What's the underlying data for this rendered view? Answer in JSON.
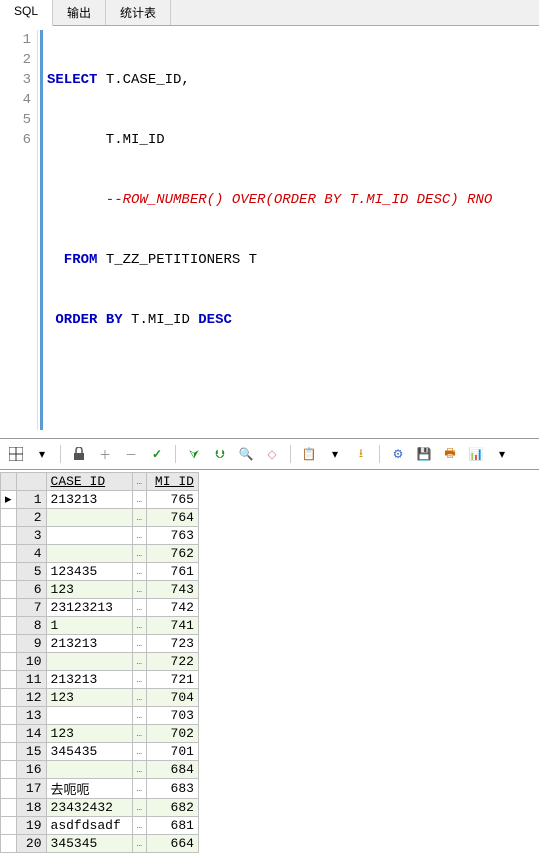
{
  "tabs": {
    "sql": "SQL",
    "output": "输出",
    "stats": "统计表"
  },
  "code": {
    "l1": {
      "kw1": "SELECT",
      "rest": " T.CASE_ID,"
    },
    "l2": {
      "rest": "       T.MI_ID"
    },
    "l3": {
      "comment": "       --ROW_NUMBER() OVER(ORDER BY T.MI_ID DESC) RNO"
    },
    "l4": {
      "kw1": "  FROM",
      "rest": " T_ZZ_PETITIONERS T"
    },
    "l5": {
      "kw1": " ORDER",
      "kw2": " BY",
      "rest1": " T.MI_ID ",
      "kw3": "DESC"
    }
  },
  "line_numbers": [
    "1",
    "2",
    "3",
    "4",
    "5",
    "6"
  ],
  "headers": {
    "case_id": "CASE_ID",
    "mi_id": "MI_ID"
  },
  "rows": [
    {
      "n": "1",
      "case_id": "213213",
      "mi_id": "765"
    },
    {
      "n": "2",
      "case_id": "",
      "mi_id": "764"
    },
    {
      "n": "3",
      "case_id": "",
      "mi_id": "763"
    },
    {
      "n": "4",
      "case_id": "",
      "mi_id": "762"
    },
    {
      "n": "5",
      "case_id": "123435",
      "mi_id": "761"
    },
    {
      "n": "6",
      "case_id": "123",
      "mi_id": "743"
    },
    {
      "n": "7",
      "case_id": "23123213",
      "mi_id": "742"
    },
    {
      "n": "8",
      "case_id": "1",
      "mi_id": "741"
    },
    {
      "n": "9",
      "case_id": "213213",
      "mi_id": "723"
    },
    {
      "n": "10",
      "case_id": "",
      "mi_id": "722"
    },
    {
      "n": "11",
      "case_id": "213213",
      "mi_id": "721"
    },
    {
      "n": "12",
      "case_id": "123",
      "mi_id": "704"
    },
    {
      "n": "13",
      "case_id": "",
      "mi_id": "703"
    },
    {
      "n": "14",
      "case_id": "123",
      "mi_id": "702"
    },
    {
      "n": "15",
      "case_id": "345435",
      "mi_id": "701"
    },
    {
      "n": "16",
      "case_id": "",
      "mi_id": "684"
    },
    {
      "n": "17",
      "case_id": "去呃呃",
      "mi_id": "683"
    },
    {
      "n": "18",
      "case_id": "23432432",
      "mi_id": "682"
    },
    {
      "n": "19",
      "case_id": "asdfdsadf",
      "mi_id": "681"
    },
    {
      "n": "20",
      "case_id": "345345",
      "mi_id": "664"
    }
  ],
  "chart_data": {
    "type": "table",
    "columns": [
      "CASE_ID",
      "MI_ID"
    ],
    "rows": [
      [
        "213213",
        765
      ],
      [
        "",
        764
      ],
      [
        "",
        763
      ],
      [
        "",
        762
      ],
      [
        "123435",
        761
      ],
      [
        "123",
        743
      ],
      [
        "23123213",
        742
      ],
      [
        "1",
        741
      ],
      [
        "213213",
        723
      ],
      [
        "",
        722
      ],
      [
        "213213",
        721
      ],
      [
        "123",
        704
      ],
      [
        "",
        703
      ],
      [
        "123",
        702
      ],
      [
        "345435",
        701
      ],
      [
        "",
        684
      ],
      [
        "去呃呃",
        683
      ],
      [
        "23432432",
        682
      ],
      [
        "asdfdsadf",
        681
      ],
      [
        "345345",
        664
      ]
    ]
  }
}
